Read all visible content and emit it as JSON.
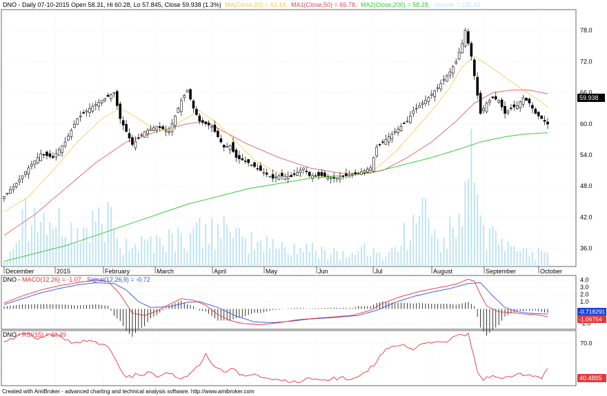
{
  "app": {
    "footer": "Created with AmiBroker - advanced charting and technical analysis software. http://www.amibroker.com"
  },
  "colors": {
    "grid": "#d9d9d9",
    "ma20": "#f2c94c",
    "ma50": "#d94a57",
    "ma200": "#33cc33",
    "volume": "#bfe4f3",
    "macd": "#e8303a",
    "signal": "#2f4fe0",
    "rsi": "#e8303a",
    "price_badge": "#000000",
    "macd_badge": "#1f3fd8",
    "signal_badge": "#e23a3a",
    "rsi_badge": "#e23a3a"
  },
  "chart_data": [
    {
      "type": "candlestick",
      "title": {
        "prefix": "DNO - Daily 07-10-2015 Open 58.31, Hi 60.28, Lo 57.845, Close 59.938 (1.3%)",
        "ma20": "MA(Close,20) = 63.19,",
        "ma50": "MA1(Close,50) = 65.78,",
        "ma200": "MA2(Close,200) = 58.28,",
        "volume": "Volume = 235.42"
      },
      "ylim": [
        32.5,
        82
      ],
      "y_ticks": [
        "78.0",
        "72.0",
        "66.0",
        "60.0",
        "54.0",
        "48.0",
        "42.0",
        "36.0"
      ],
      "x_ticks": [
        "December",
        "2015",
        "February",
        "March",
        "April",
        "May",
        "Jun",
        "Jul",
        "August",
        "September",
        "October"
      ],
      "last_close_label": "59.938",
      "price_waypoints": [
        [
          0,
          46.0
        ],
        [
          4,
          48.5
        ],
        [
          8,
          51.5
        ],
        [
          12,
          54.2
        ],
        [
          16,
          53.5
        ],
        [
          20,
          56.5
        ],
        [
          24,
          61.0
        ],
        [
          28,
          63.0
        ],
        [
          32,
          64.5
        ],
        [
          36,
          66.0
        ],
        [
          38,
          61.0
        ],
        [
          40,
          58.5
        ],
        [
          42,
          56.0
        ],
        [
          46,
          58.5
        ],
        [
          50,
          59.5
        ],
        [
          54,
          58.5
        ],
        [
          56,
          61.5
        ],
        [
          58,
          64.5
        ],
        [
          60,
          66.5
        ],
        [
          62,
          63.0
        ],
        [
          64,
          60.5
        ],
        [
          68,
          59.5
        ],
        [
          70,
          57.5
        ],
        [
          72,
          55.5
        ],
        [
          74,
          55.8
        ],
        [
          76,
          53.5
        ],
        [
          80,
          52.5
        ],
        [
          84,
          51.0
        ],
        [
          88,
          49.5
        ],
        [
          90,
          50.0
        ],
        [
          94,
          49.8
        ],
        [
          98,
          51.5
        ],
        [
          100,
          50.0
        ],
        [
          104,
          50.0
        ],
        [
          108,
          49.5
        ],
        [
          112,
          50.0
        ],
        [
          116,
          50.5
        ],
        [
          120,
          51.5
        ],
        [
          122,
          55.5
        ],
        [
          124,
          56.5
        ],
        [
          128,
          58.5
        ],
        [
          132,
          60.5
        ],
        [
          134,
          62.5
        ],
        [
          138,
          64.5
        ],
        [
          142,
          67.0
        ],
        [
          146,
          70.0
        ],
        [
          148,
          72.0
        ],
        [
          150,
          75.5
        ],
        [
          151,
          78.0
        ],
        [
          153,
          73.0
        ],
        [
          155,
          65.5
        ],
        [
          156,
          62.0
        ],
        [
          158,
          64.0
        ],
        [
          160,
          65.0
        ],
        [
          162,
          64.5
        ],
        [
          164,
          62.0
        ],
        [
          166,
          63.0
        ],
        [
          168,
          63.5
        ],
        [
          170,
          65.0
        ],
        [
          172,
          64.0
        ],
        [
          174,
          62.0
        ],
        [
          176,
          61.0
        ],
        [
          178,
          59.938
        ]
      ],
      "ma20_waypoints": [
        [
          0,
          43.0
        ],
        [
          8,
          46.0
        ],
        [
          16,
          51.0
        ],
        [
          24,
          56.5
        ],
        [
          32,
          61.0
        ],
        [
          38,
          63.0
        ],
        [
          44,
          61.0
        ],
        [
          50,
          58.5
        ],
        [
          54,
          59.0
        ],
        [
          58,
          60.5
        ],
        [
          64,
          62.5
        ],
        [
          70,
          60.0
        ],
        [
          76,
          56.5
        ],
        [
          82,
          53.0
        ],
        [
          88,
          51.0
        ],
        [
          94,
          50.0
        ],
        [
          100,
          50.0
        ],
        [
          108,
          50.0
        ],
        [
          116,
          50.2
        ],
        [
          122,
          51.5
        ],
        [
          128,
          54.5
        ],
        [
          134,
          58.5
        ],
        [
          140,
          62.5
        ],
        [
          146,
          67.0
        ],
        [
          150,
          71.0
        ],
        [
          154,
          73.0
        ],
        [
          158,
          71.5
        ],
        [
          164,
          69.0
        ],
        [
          170,
          66.5
        ],
        [
          176,
          64.2
        ],
        [
          178,
          63.19
        ]
      ],
      "ma50_waypoints": [
        [
          0,
          38.5
        ],
        [
          10,
          42.5
        ],
        [
          20,
          47.5
        ],
        [
          30,
          52.5
        ],
        [
          40,
          56.5
        ],
        [
          50,
          58.5
        ],
        [
          60,
          60.0
        ],
        [
          66,
          60.5
        ],
        [
          72,
          58.5
        ],
        [
          80,
          56.0
        ],
        [
          90,
          53.5
        ],
        [
          100,
          51.5
        ],
        [
          110,
          50.5
        ],
        [
          118,
          50.5
        ],
        [
          124,
          51.0
        ],
        [
          132,
          53.5
        ],
        [
          140,
          56.5
        ],
        [
          148,
          60.5
        ],
        [
          154,
          64.0
        ],
        [
          160,
          66.0
        ],
        [
          166,
          66.5
        ],
        [
          172,
          66.5
        ],
        [
          178,
          65.78
        ]
      ],
      "ma200_waypoints": [
        [
          0,
          33.5
        ],
        [
          10,
          35.0
        ],
        [
          20,
          36.5
        ],
        [
          30,
          38.5
        ],
        [
          40,
          40.5
        ],
        [
          50,
          42.5
        ],
        [
          60,
          44.5
        ],
        [
          70,
          46.0
        ],
        [
          80,
          47.5
        ],
        [
          90,
          48.5
        ],
        [
          100,
          49.5
        ],
        [
          110,
          50.0
        ],
        [
          120,
          50.5
        ],
        [
          130,
          52.0
        ],
        [
          140,
          53.5
        ],
        [
          150,
          55.3
        ],
        [
          156,
          56.5
        ],
        [
          164,
          57.5
        ],
        [
          170,
          58.0
        ],
        [
          178,
          58.28
        ]
      ],
      "volume_peaks": [
        [
          0,
          2
        ],
        [
          7,
          30
        ],
        [
          24,
          17
        ],
        [
          35,
          26
        ],
        [
          36,
          16
        ],
        [
          40,
          12
        ],
        [
          62,
          17
        ],
        [
          72,
          22
        ],
        [
          74,
          15
        ],
        [
          88,
          12
        ],
        [
          95,
          10
        ],
        [
          108,
          8
        ],
        [
          114,
          6
        ],
        [
          118,
          10
        ],
        [
          122,
          6
        ],
        [
          127,
          8
        ],
        [
          137,
          30
        ],
        [
          142,
          12
        ],
        [
          149,
          23
        ],
        [
          152,
          38
        ],
        [
          153,
          60
        ],
        [
          157,
          18
        ],
        [
          166,
          9
        ],
        [
          176,
          7
        ],
        [
          178,
          6
        ]
      ],
      "volume_max": 60
    },
    {
      "type": "line",
      "title": {
        "prefix": "DNO - ",
        "macd": "MACD(12,26) = -1.07,",
        "signal": "Signal(12,26,9) = -0.72"
      },
      "ylim": [
        -2.8,
        4.6
      ],
      "y_ticks": [
        "4.0",
        "3.0",
        "2.0",
        "1.0",
        "-2.0"
      ],
      "series": [
        {
          "name": "MACD(12,26)",
          "waypoints": [
            [
              0,
              0.8
            ],
            [
              6,
              1.8
            ],
            [
              12,
              2.6
            ],
            [
              18,
              3.2
            ],
            [
              24,
              3.6
            ],
            [
              30,
              4.0
            ],
            [
              34,
              3.8
            ],
            [
              38,
              2.0
            ],
            [
              42,
              -0.6
            ],
            [
              46,
              -0.9
            ],
            [
              50,
              -0.3
            ],
            [
              54,
              0.6
            ],
            [
              58,
              1.4
            ],
            [
              62,
              1.2
            ],
            [
              66,
              0.5
            ],
            [
              70,
              -0.8
            ],
            [
              74,
              -1.6
            ],
            [
              78,
              -2.0
            ],
            [
              84,
              -2.2
            ],
            [
              90,
              -1.9
            ],
            [
              96,
              -1.5
            ],
            [
              102,
              -1.3
            ],
            [
              108,
              -1.1
            ],
            [
              114,
              -0.9
            ],
            [
              120,
              -0.2
            ],
            [
              124,
              0.8
            ],
            [
              130,
              1.7
            ],
            [
              136,
              2.4
            ],
            [
              142,
              2.9
            ],
            [
              148,
              3.4
            ],
            [
              152,
              4.1
            ],
            [
              154,
              3.8
            ],
            [
              156,
              2.0
            ],
            [
              158,
              0.4
            ],
            [
              162,
              -0.4
            ],
            [
              166,
              -0.5
            ],
            [
              170,
              -0.7
            ],
            [
              174,
              -0.8
            ],
            [
              178,
              -1.07
            ]
          ]
        },
        {
          "name": "Signal(12,26,9)",
          "waypoints": [
            [
              0,
              0.6
            ],
            [
              6,
              1.4
            ],
            [
              12,
              2.2
            ],
            [
              18,
              2.8
            ],
            [
              24,
              3.3
            ],
            [
              30,
              3.6
            ],
            [
              36,
              3.5
            ],
            [
              40,
              2.6
            ],
            [
              44,
              1.0
            ],
            [
              48,
              0.2
            ],
            [
              54,
              0.3
            ],
            [
              60,
              0.9
            ],
            [
              64,
              1.0
            ],
            [
              70,
              0.2
            ],
            [
              76,
              -1.0
            ],
            [
              82,
              -1.8
            ],
            [
              88,
              -1.9
            ],
            [
              94,
              -1.7
            ],
            [
              100,
              -1.4
            ],
            [
              108,
              -1.2
            ],
            [
              116,
              -0.9
            ],
            [
              122,
              -0.2
            ],
            [
              128,
              0.9
            ],
            [
              134,
              1.7
            ],
            [
              140,
              2.3
            ],
            [
              146,
              2.8
            ],
            [
              152,
              3.5
            ],
            [
              156,
              3.6
            ],
            [
              160,
              1.8
            ],
            [
              164,
              0.2
            ],
            [
              168,
              -0.4
            ],
            [
              172,
              -0.6
            ],
            [
              178,
              -0.72
            ]
          ]
        }
      ],
      "histogram": {
        "name": "MACD - Signal"
      },
      "macd_badge": "-0.718291",
      "signal_badge": "-1.06754"
    },
    {
      "type": "line",
      "title": {
        "prefix": "DNO - ",
        "rsi": "RSI(15) = 40.49"
      },
      "ylim": [
        20,
        85
      ],
      "y_ticks": [
        "70.0"
      ],
      "series": [
        {
          "name": "RSI(15)",
          "waypoints": [
            [
              0,
              72
            ],
            [
              4,
              78
            ],
            [
              8,
              82
            ],
            [
              10,
              76
            ],
            [
              14,
              80
            ],
            [
              18,
              79
            ],
            [
              22,
              70
            ],
            [
              26,
              74
            ],
            [
              30,
              72
            ],
            [
              34,
              66
            ],
            [
              36,
              54
            ],
            [
              40,
              30
            ],
            [
              44,
              33
            ],
            [
              48,
              36
            ],
            [
              50,
              30
            ],
            [
              54,
              34
            ],
            [
              58,
              28
            ],
            [
              62,
              38
            ],
            [
              64,
              44
            ],
            [
              66,
              58
            ],
            [
              68,
              46
            ],
            [
              72,
              36
            ],
            [
              74,
              40
            ],
            [
              78,
              33
            ],
            [
              82,
              34
            ],
            [
              86,
              29
            ],
            [
              90,
              27
            ],
            [
              94,
              24
            ],
            [
              98,
              26
            ],
            [
              102,
              28
            ],
            [
              106,
              26
            ],
            [
              110,
              30
            ],
            [
              114,
              28
            ],
            [
              118,
              36
            ],
            [
              122,
              48
            ],
            [
              124,
              58
            ],
            [
              126,
              64
            ],
            [
              130,
              68
            ],
            [
              134,
              62
            ],
            [
              138,
              70
            ],
            [
              142,
              72
            ],
            [
              146,
              74
            ],
            [
              150,
              80
            ],
            [
              152,
              82
            ],
            [
              153,
              66
            ],
            [
              155,
              36
            ],
            [
              157,
              26
            ],
            [
              160,
              32
            ],
            [
              164,
              30
            ],
            [
              168,
              34
            ],
            [
              172,
              33
            ],
            [
              176,
              28
            ],
            [
              178,
              40.49
            ]
          ]
        }
      ],
      "last_label": "40.4885"
    }
  ]
}
